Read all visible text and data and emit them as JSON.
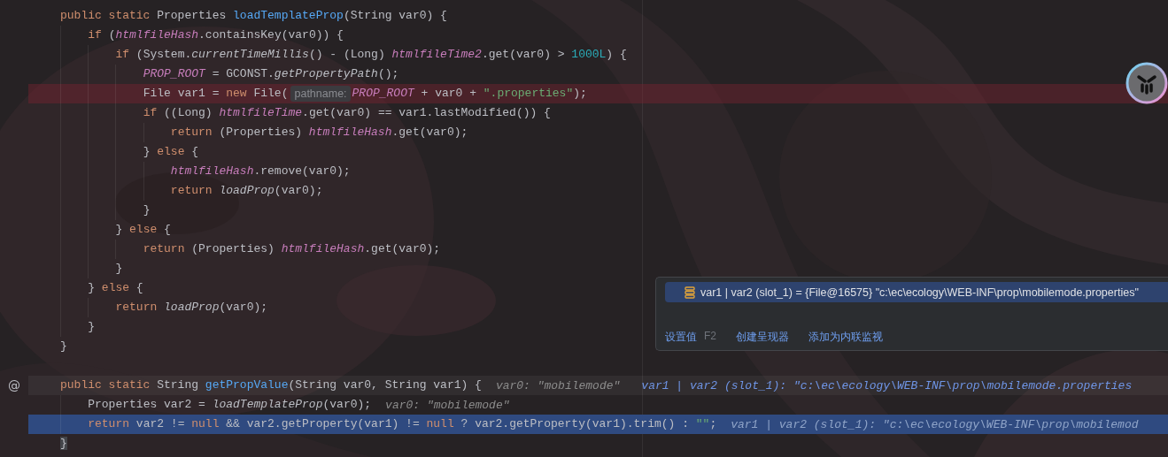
{
  "editor": {
    "lines": [
      {
        "kind": "normal",
        "segments": [
          {
            "kind": "code",
            "tokens": [
              {
                "text": "public static ",
                "kind": "keyword"
              },
              {
                "text": "Properties ",
                "kind": "plain"
              },
              {
                "text": "loadTemplateProp",
                "kind": "declaration"
              },
              {
                "text": "(String var0) {",
                "kind": "plain"
              }
            ]
          }
        ]
      },
      {
        "kind": "normal",
        "segments": [
          {
            "kind": "code",
            "tokens": [
              {
                "text": "    if ",
                "kind": "keyword"
              },
              {
                "text": "(",
                "kind": "plain"
              },
              {
                "text": "htmlfileHash",
                "kind": "field"
              },
              {
                "text": ".containsKey(var0)) {",
                "kind": "plain"
              }
            ]
          }
        ]
      },
      {
        "kind": "normal",
        "segments": [
          {
            "kind": "code",
            "tokens": [
              {
                "text": "        if ",
                "kind": "keyword"
              },
              {
                "text": "(System.",
                "kind": "plain"
              },
              {
                "text": "currentTimeMillis",
                "kind": "static"
              },
              {
                "text": "() - (Long) ",
                "kind": "plain"
              },
              {
                "text": "htmlfileTime2",
                "kind": "field"
              },
              {
                "text": ".get(var0) > ",
                "kind": "plain"
              },
              {
                "text": "1000L",
                "kind": "number"
              },
              {
                "text": ") {",
                "kind": "plain"
              }
            ]
          }
        ]
      },
      {
        "kind": "normal",
        "segments": [
          {
            "kind": "code",
            "tokens": [
              {
                "text": "            PROP_ROOT",
                "kind": "field"
              },
              {
                "text": " = GCONST.",
                "kind": "plain"
              },
              {
                "text": "getPropertyPath",
                "kind": "static"
              },
              {
                "text": "();",
                "kind": "plain"
              }
            ]
          }
        ]
      },
      {
        "kind": "breakpoint",
        "segments": [
          {
            "kind": "code",
            "tokens": [
              {
                "text": "            File var1 = ",
                "kind": "plain"
              },
              {
                "text": "new ",
                "kind": "keyword"
              },
              {
                "text": "File(",
                "kind": "plain"
              }
            ]
          },
          {
            "kind": "param_hint",
            "text": "pathname:"
          },
          {
            "kind": "code",
            "tokens": [
              {
                "text": "PROP_ROOT",
                "kind": "field"
              },
              {
                "text": " + var0 + ",
                "kind": "plain"
              },
              {
                "text": "\".properties\"",
                "kind": "string"
              },
              {
                "text": ");",
                "kind": "plain"
              }
            ]
          }
        ]
      },
      {
        "kind": "normal",
        "segments": [
          {
            "kind": "code",
            "tokens": [
              {
                "text": "            if ",
                "kind": "keyword"
              },
              {
                "text": "((Long) ",
                "kind": "plain"
              },
              {
                "text": "htmlfileTime",
                "kind": "field"
              },
              {
                "text": ".get(var0) == var1.lastModified()) {",
                "kind": "plain"
              }
            ]
          }
        ]
      },
      {
        "kind": "normal",
        "segments": [
          {
            "kind": "code",
            "tokens": [
              {
                "text": "                return ",
                "kind": "keyword"
              },
              {
                "text": "(Properties) ",
                "kind": "plain"
              },
              {
                "text": "htmlfileHash",
                "kind": "field"
              },
              {
                "text": ".get(var0);",
                "kind": "plain"
              }
            ]
          }
        ]
      },
      {
        "kind": "normal",
        "segments": [
          {
            "kind": "code",
            "tokens": [
              {
                "text": "            } ",
                "kind": "plain"
              },
              {
                "text": "else ",
                "kind": "keyword"
              },
              {
                "text": "{",
                "kind": "plain"
              }
            ]
          }
        ]
      },
      {
        "kind": "normal",
        "segments": [
          {
            "kind": "code",
            "tokens": [
              {
                "text": "                htmlfileHash",
                "kind": "field"
              },
              {
                "text": ".remove(var0);",
                "kind": "plain"
              }
            ]
          }
        ]
      },
      {
        "kind": "normal",
        "segments": [
          {
            "kind": "code",
            "tokens": [
              {
                "text": "                return ",
                "kind": "keyword"
              },
              {
                "text": "loadProp",
                "kind": "static"
              },
              {
                "text": "(var0);",
                "kind": "plain"
              }
            ]
          }
        ]
      },
      {
        "kind": "normal",
        "segments": [
          {
            "kind": "code",
            "tokens": [
              {
                "text": "            }",
                "kind": "plain"
              }
            ]
          }
        ]
      },
      {
        "kind": "normal",
        "segments": [
          {
            "kind": "code",
            "tokens": [
              {
                "text": "        } ",
                "kind": "plain"
              },
              {
                "text": "else ",
                "kind": "keyword"
              },
              {
                "text": "{",
                "kind": "plain"
              }
            ]
          }
        ]
      },
      {
        "kind": "normal",
        "segments": [
          {
            "kind": "code",
            "tokens": [
              {
                "text": "            return ",
                "kind": "keyword"
              },
              {
                "text": "(Properties) ",
                "kind": "plain"
              },
              {
                "text": "htmlfileHash",
                "kind": "field"
              },
              {
                "text": ".get(var0);",
                "kind": "plain"
              }
            ]
          }
        ]
      },
      {
        "kind": "normal",
        "segments": [
          {
            "kind": "code",
            "tokens": [
              {
                "text": "        }",
                "kind": "plain"
              }
            ]
          }
        ]
      },
      {
        "kind": "normal",
        "segments": [
          {
            "kind": "code",
            "tokens": [
              {
                "text": "    } ",
                "kind": "plain"
              },
              {
                "text": "else ",
                "kind": "keyword"
              },
              {
                "text": "{",
                "kind": "plain"
              }
            ]
          }
        ]
      },
      {
        "kind": "normal",
        "segments": [
          {
            "kind": "code",
            "tokens": [
              {
                "text": "        return ",
                "kind": "keyword"
              },
              {
                "text": "loadProp",
                "kind": "static"
              },
              {
                "text": "(var0);",
                "kind": "plain"
              }
            ]
          }
        ]
      },
      {
        "kind": "normal",
        "segments": [
          {
            "kind": "code",
            "tokens": [
              {
                "text": "    }",
                "kind": "plain"
              }
            ]
          }
        ]
      },
      {
        "kind": "normal",
        "segments": [
          {
            "kind": "code",
            "tokens": [
              {
                "text": "}",
                "kind": "plain"
              }
            ]
          }
        ]
      },
      {
        "kind": "normal"
      },
      {
        "kind": "caret",
        "gutter": "@",
        "segments": [
          {
            "kind": "code",
            "tokens": [
              {
                "text": "public static ",
                "kind": "keyword"
              },
              {
                "text": "String ",
                "kind": "plain"
              },
              {
                "text": "getPropValue",
                "kind": "declaration"
              },
              {
                "text": "(String var0, String var1) {",
                "kind": "plain"
              }
            ]
          },
          {
            "kind": "inline_value",
            "text": "var0: \"mobilemode\""
          },
          {
            "kind": "inline_watch",
            "text": "var1 | var2 (slot_1): \"c:\\ec\\ecology\\WEB-INF\\prop\\mobilemode.properties"
          }
        ]
      },
      {
        "kind": "normal",
        "segments": [
          {
            "kind": "code",
            "tokens": [
              {
                "text": "    Properties var2 = ",
                "kind": "plain"
              },
              {
                "text": "loadTemplateProp",
                "kind": "static"
              },
              {
                "text": "(var0);",
                "kind": "plain"
              }
            ]
          },
          {
            "kind": "inline_value",
            "text": "var0: \"mobilemode\""
          }
        ]
      },
      {
        "kind": "execution",
        "segments": [
          {
            "kind": "code",
            "tokens": [
              {
                "text": "    return ",
                "kind": "keyword"
              },
              {
                "text": "var2 != ",
                "kind": "plain"
              },
              {
                "text": "null ",
                "kind": "keyword"
              },
              {
                "text": "&& var2.getProperty(var1) != ",
                "kind": "plain"
              },
              {
                "text": "null ",
                "kind": "keyword"
              },
              {
                "text": "? var2.getProperty(var1).trim() : ",
                "kind": "plain"
              },
              {
                "text": "\"\"",
                "kind": "string"
              },
              {
                "text": ";",
                "kind": "plain"
              }
            ]
          },
          {
            "kind": "inline_value",
            "text": "var1 | var2 (slot_1): \"c:\\ec\\ecology\\WEB-INF\\prop\\mobilemod"
          }
        ]
      },
      {
        "kind": "normal",
        "segments": [
          {
            "kind": "code",
            "tokens": [
              {
                "text": "}",
                "kind": "brace"
              }
            ]
          }
        ]
      }
    ]
  },
  "popup": {
    "rows": [
      {
        "text": "var1 | var2 (slot_1) = {File@16575} \"c:\\ec\\ecology\\WEB-INF\\prop\\mobilemode.properties\"",
        "selected": true
      }
    ],
    "actions": [
      {
        "label": "设置值",
        "shortcut": "F2"
      },
      {
        "label": "创建呈现器"
      },
      {
        "label": "添加为内联监视"
      }
    ]
  }
}
